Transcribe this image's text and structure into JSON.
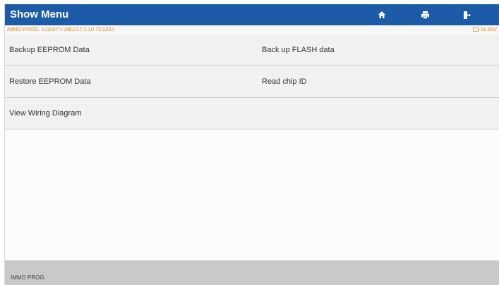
{
  "titlebar": {
    "title": "Show Menu",
    "icons": [
      "home-icon",
      "print-icon",
      "exit-icon"
    ]
  },
  "pathbar": {
    "path": "IMMO PROG. V10.07 > MED17.1.10 TC1293",
    "voltage": "11.95V"
  },
  "menu": {
    "items": [
      {
        "label": "Backup EEPROM Data"
      },
      {
        "label": "Back up FLASH data"
      },
      {
        "label": "Restore EEPROM Data"
      },
      {
        "label": "Read chip ID"
      },
      {
        "label": "View Wiring Diagram"
      }
    ]
  },
  "footer": {
    "label": "IMMO PROG."
  },
  "colors": {
    "titlebar": "#1c5ba8",
    "path_text": "#f08a1c",
    "row_bg": "#f1f1f1",
    "footer_bg": "#c9c9c9"
  }
}
